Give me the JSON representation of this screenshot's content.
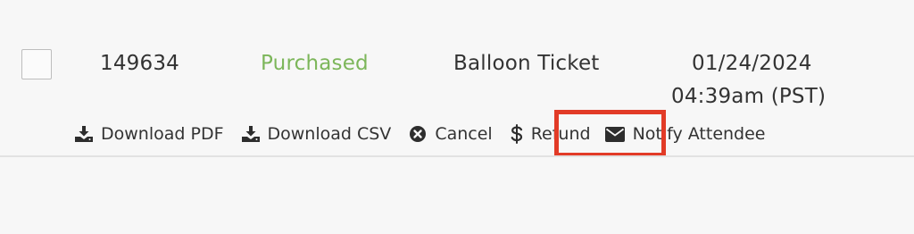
{
  "row": {
    "order_id": "149634",
    "status": "Purchased",
    "item": "Balloon Ticket",
    "date": "01/24/2024",
    "time": "04:39am (PST)"
  },
  "actions": {
    "download_pdf": "Download PDF",
    "download_csv": "Download CSV",
    "cancel": "Cancel",
    "refund": "Refund",
    "notify_attendee": "Notify Attendee"
  },
  "icons": {
    "download_pdf": "download-icon",
    "download_csv": "download-icon",
    "cancel": "close-circle-icon",
    "refund": "dollar-icon",
    "notify_attendee": "envelope-icon"
  },
  "colors": {
    "status_purchased": "#7cb65a",
    "highlight": "#e23b27",
    "text": "#333333",
    "background": "#f7f7f7"
  }
}
